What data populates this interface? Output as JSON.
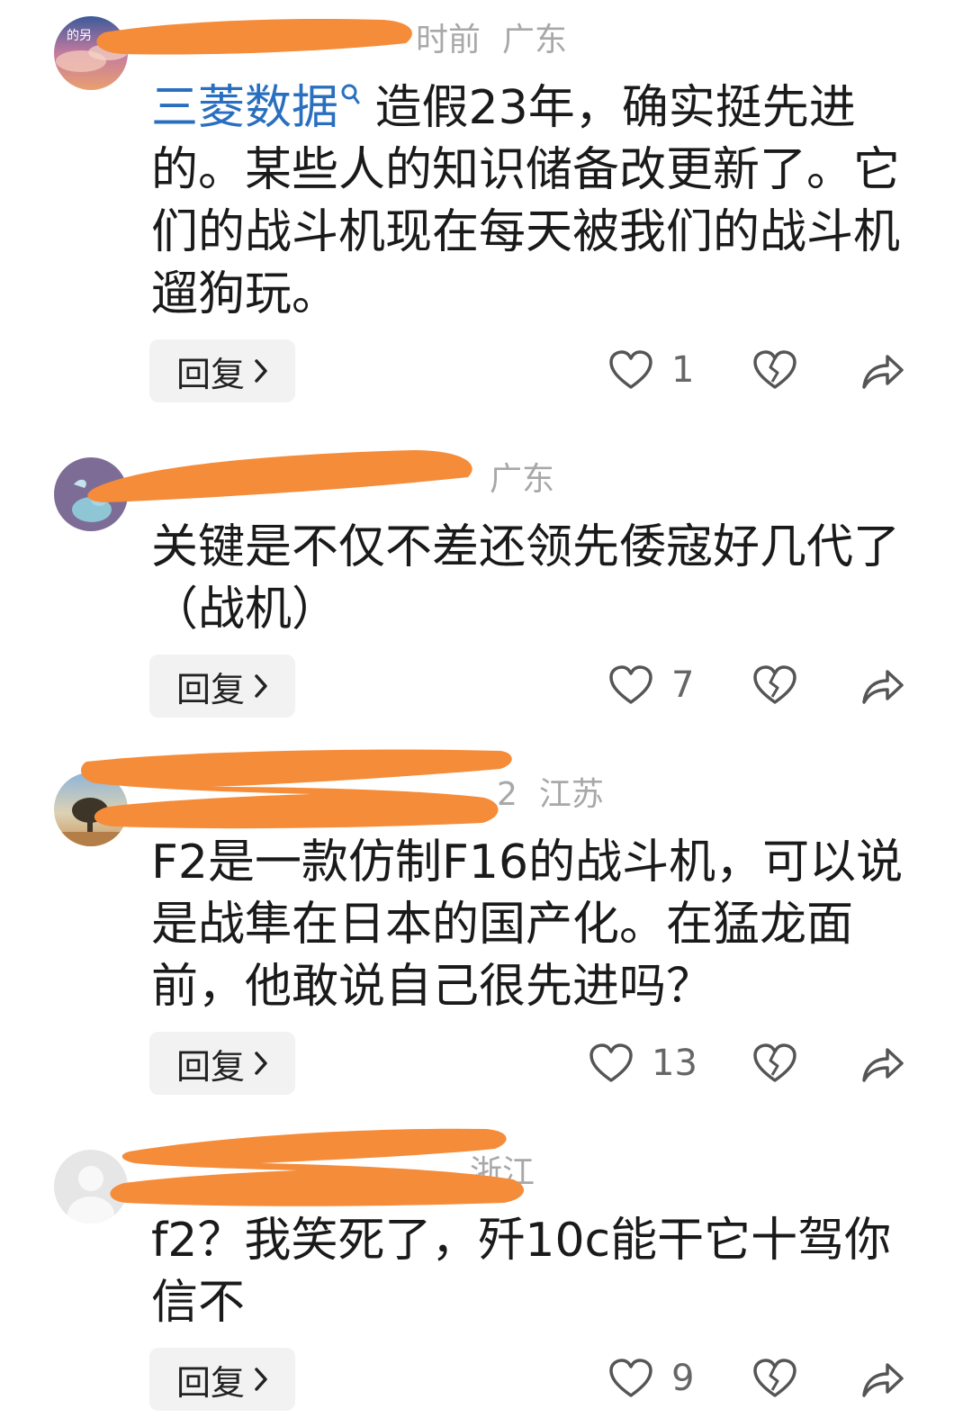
{
  "comments": [
    {
      "meta_suffix": "时前",
      "location": "广东",
      "topic_link": "三菱数据",
      "body": "造假23年，确实挺先进的。某些人的知识储备改更新了。它们的战斗机现在每天被我们的战斗机遛狗玩。",
      "reply_label": "回复",
      "likes": "1",
      "avatar_text": "的另"
    },
    {
      "meta_suffix": "",
      "location": "广东",
      "topic_link": "",
      "body": "关键是不仅不差还领先倭寇好几代了（战机）",
      "reply_label": "回复",
      "likes": "7"
    },
    {
      "meta_suffix": "2",
      "location": "江苏",
      "topic_link": "",
      "body": "F2是一款仿制F16的战斗机，可以说是战隼在日本的国产化。在猛龙面前，他敢说自己很先进吗？",
      "reply_label": "回复",
      "likes": "13"
    },
    {
      "meta_suffix": "",
      "location": "浙江",
      "topic_link": "",
      "body": "f2？我笑死了，歼10c能干它十驾你信不",
      "reply_label": "回复",
      "likes": "9"
    }
  ],
  "icons": {
    "like": "heart-outline-icon",
    "dislike": "broken-heart-icon",
    "share": "share-arrow-icon",
    "reply_chevron": "chevron-right-icon",
    "topic_search": "search-icon"
  },
  "colors": {
    "redaction": "#f58c3a",
    "link": "#2a6fbf",
    "text": "#1a1a1a",
    "meta": "#a8a8a8",
    "reply_bg": "#f2f2f2"
  }
}
